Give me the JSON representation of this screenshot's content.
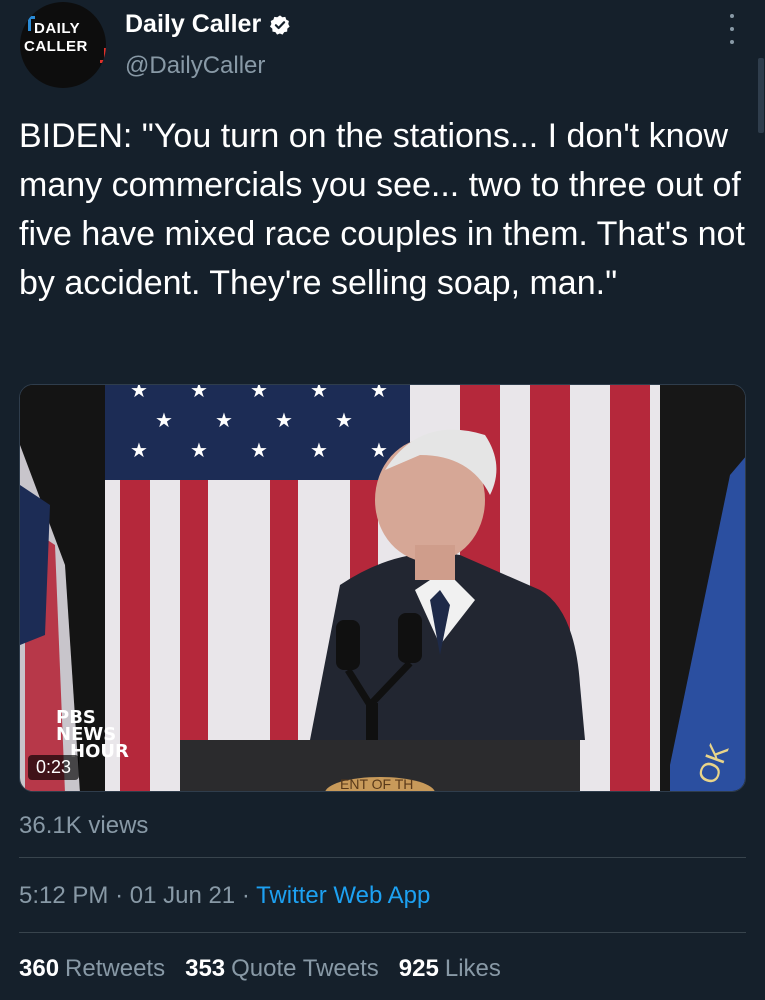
{
  "account": {
    "avatar_text_line1": "DAILY",
    "avatar_text_line2": "CALLER",
    "name": "Daily Caller",
    "handle": "@DailyCaller"
  },
  "tweet": {
    "text": "BIDEN: \"You turn on the stations... I don't know many commercials you see... two to three out of five have mixed race couples in them. That's not by accident. They're selling soap, man.\""
  },
  "media": {
    "logo_line1": "PBS",
    "logo_line2": "NEWS",
    "logo_line3": "HOUR",
    "duration": "0:23",
    "podium_text": "ENT OF TH",
    "flag_text": "OK"
  },
  "views": "36.1K views",
  "meta": {
    "time": "5:12 PM",
    "separator": "·",
    "date": "01 Jun 21",
    "app": "Twitter Web App"
  },
  "stats": {
    "retweets_count": "360",
    "retweets_label": "Retweets",
    "quotes_count": "353",
    "quotes_label": "Quote Tweets",
    "likes_count": "925",
    "likes_label": "Likes"
  },
  "colors": {
    "background": "#15202b",
    "secondary_text": "#8899a6",
    "link": "#1da1f2",
    "divider": "#38444d"
  }
}
